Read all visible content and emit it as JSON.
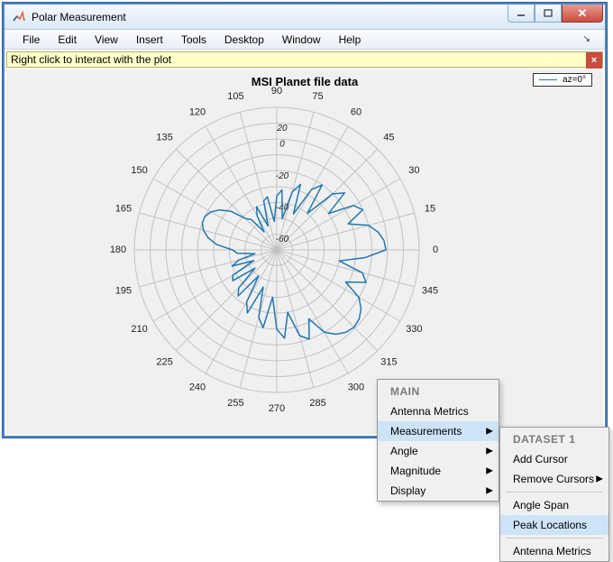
{
  "window": {
    "title": "Polar Measurement",
    "menubar": [
      "File",
      "Edit",
      "View",
      "Insert",
      "Tools",
      "Desktop",
      "Window",
      "Help"
    ],
    "hint": "Right click to interact with the plot"
  },
  "plot": {
    "title": "MSI Planet file data",
    "legend": "az=0°"
  },
  "chart_data": {
    "type": "polar-line",
    "title": "MSI Planet file data",
    "angle_deg_start": 0,
    "angle_deg_step": 15,
    "angle_labels": [
      "0",
      "15",
      "30",
      "45",
      "60",
      "75",
      "90",
      "105",
      "120",
      "135",
      "150",
      "165",
      "180",
      "195",
      "210",
      "225",
      "240",
      "255",
      "270",
      "285",
      "300",
      "315",
      "330",
      "345"
    ],
    "radial_labels": [
      "20",
      "0",
      "-20",
      "-40",
      "-60"
    ],
    "radial_min": -70,
    "radial_max": 20,
    "series": [
      {
        "name": "az=0°",
        "gain_db_per5deg": [
          -1,
          -2,
          -5,
          -10,
          -22,
          -10,
          -14,
          -30,
          -14,
          -20,
          -40,
          -20,
          -26,
          -45,
          -26,
          -32,
          -50,
          -32,
          -36,
          -52,
          -36,
          -38,
          -54,
          -40,
          -45,
          -56,
          -45,
          -42,
          -32,
          -26,
          -22,
          -20,
          -20,
          -22,
          -26,
          -32,
          -42,
          -45,
          -56,
          -45,
          -40,
          -54,
          -38,
          -36,
          -52,
          -36,
          -32,
          -50,
          -32,
          -26,
          -45,
          -26,
          -20,
          -40,
          -20,
          -14,
          -30,
          -14,
          -10,
          -22,
          -10,
          -5,
          -2,
          -1,
          -2,
          -5,
          -10,
          -22,
          -10,
          -14,
          -30,
          -14
        ]
      }
    ],
    "layout": {
      "legend_pos": "top-right",
      "grid": true,
      "zero_at": "east"
    }
  },
  "angleTicks": [
    0,
    15,
    30,
    45,
    60,
    75,
    90,
    105,
    120,
    135,
    150,
    165,
    180,
    195,
    210,
    225,
    240,
    255,
    270,
    285,
    300,
    315,
    330,
    345
  ],
  "radialTicks": [
    {
      "r_norm": 1.0,
      "label": ""
    },
    {
      "r_norm": 0.889,
      "label": "20"
    },
    {
      "r_norm": 0.778,
      "label": "0"
    },
    {
      "r_norm": 0.667,
      "label": ""
    },
    {
      "r_norm": 0.556,
      "label": "-20"
    },
    {
      "r_norm": 0.444,
      "label": ""
    },
    {
      "r_norm": 0.333,
      "label": "-40"
    },
    {
      "r_norm": 0.222,
      "label": ""
    },
    {
      "r_norm": 0.111,
      "label": "-60"
    }
  ],
  "context": {
    "main": {
      "header": "MAIN",
      "items": [
        {
          "label": "Antenna Metrics",
          "arrow": false,
          "hl": false
        },
        {
          "label": "Measurements",
          "arrow": true,
          "hl": true
        },
        {
          "label": "Angle",
          "arrow": true,
          "hl": false
        },
        {
          "label": "Magnitude",
          "arrow": true,
          "hl": false
        },
        {
          "label": "Display",
          "arrow": true,
          "hl": false
        }
      ]
    },
    "sub": {
      "header": "DATASET 1",
      "items": [
        {
          "label": "Add Cursor",
          "arrow": false,
          "hl": false
        },
        {
          "label": "Remove Cursors",
          "arrow": true,
          "hl": false
        },
        {
          "label": "Angle Span",
          "arrow": false,
          "hl": false,
          "sep_before": true
        },
        {
          "label": "Peak Locations",
          "arrow": false,
          "hl": true
        },
        {
          "label": "Antenna Metrics",
          "arrow": false,
          "hl": false,
          "sep_before": true
        }
      ]
    }
  }
}
